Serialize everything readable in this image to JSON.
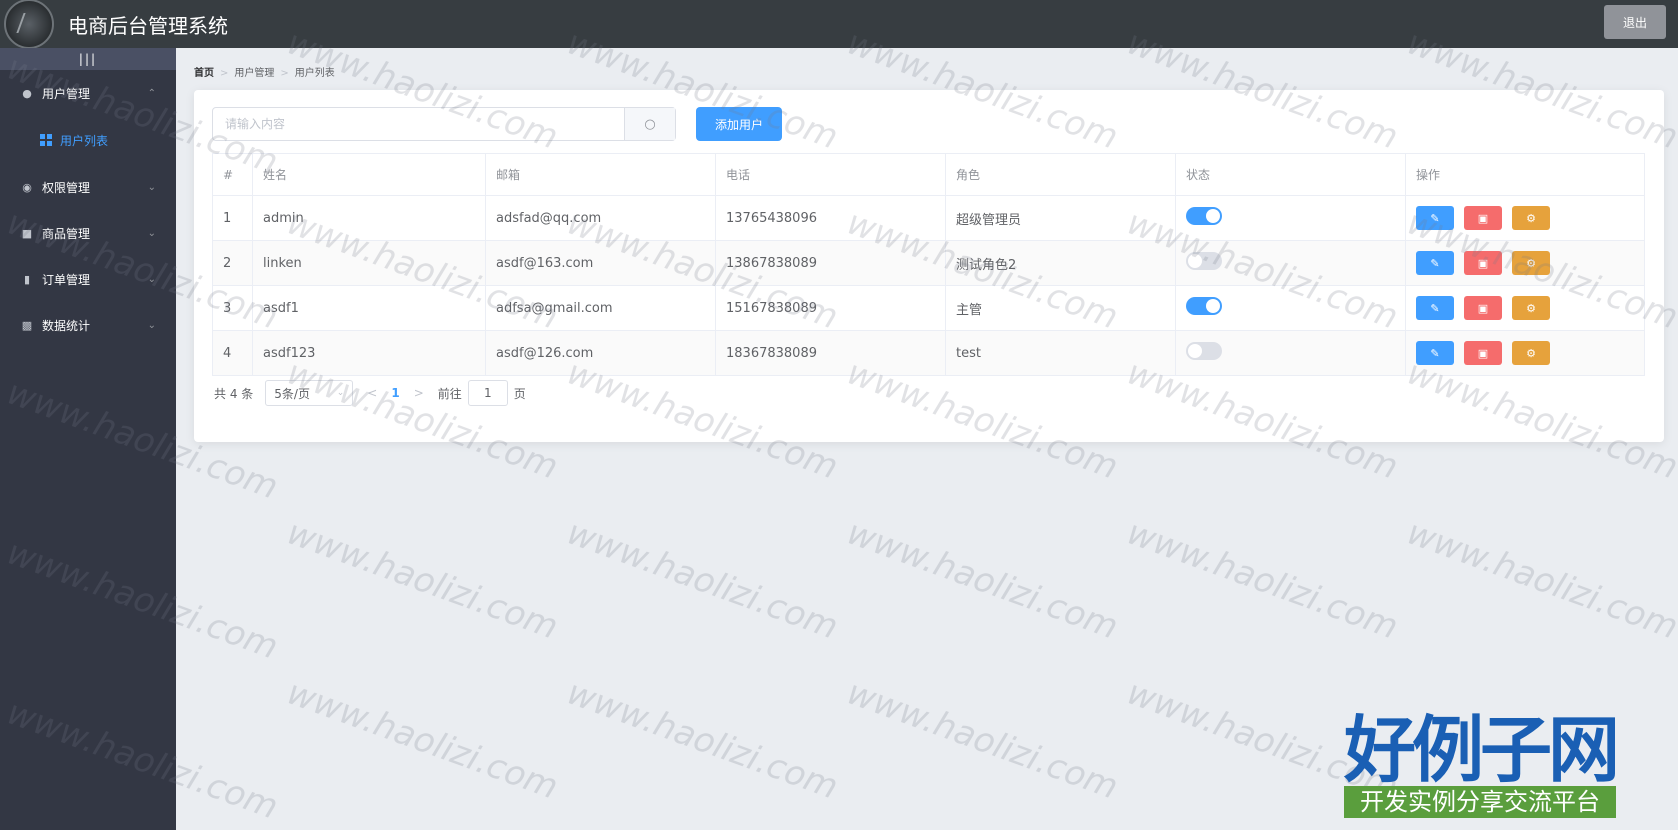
{
  "header": {
    "title": "电商后台管理系统",
    "logout_label": "退出"
  },
  "sidebar": {
    "toggle_label": "|||",
    "menus": [
      {
        "label": "用户管理",
        "icon": "user-icon",
        "chevron": "⌃"
      },
      {
        "label": "权限管理",
        "icon": "location-icon",
        "chevron": "⌄"
      },
      {
        "label": "商品管理",
        "icon": "goods-icon",
        "chevron": "⌄"
      },
      {
        "label": "订单管理",
        "icon": "order-icon",
        "chevron": "⌄"
      },
      {
        "label": "数据统计",
        "icon": "chart-icon",
        "chevron": "⌄"
      }
    ],
    "submenu": {
      "label": "用户列表",
      "icon": "grid-icon"
    }
  },
  "breadcrumb": [
    "首页",
    "用户管理",
    "用户列表"
  ],
  "search": {
    "placeholder": "请输入内容",
    "value": ""
  },
  "add_button_label": "添加用户",
  "table": {
    "columns": [
      "#",
      "姓名",
      "邮箱",
      "电话",
      "角色",
      "状态",
      "操作"
    ],
    "rows": [
      {
        "index": "1",
        "name": "admin",
        "email": "adsfad@qq.com",
        "phone": "13765438096",
        "role": "超级管理员",
        "status": true
      },
      {
        "index": "2",
        "name": "linken",
        "email": "asdf@163.com",
        "phone": "13867838089",
        "role": "测试角色2",
        "status": false
      },
      {
        "index": "3",
        "name": "asdf1",
        "email": "adfsa@gmail.com",
        "phone": "15167838089",
        "role": "主管",
        "status": true
      },
      {
        "index": "4",
        "name": "asdf123",
        "email": "asdf@126.com",
        "phone": "18367838089",
        "role": "test",
        "status": false
      }
    ]
  },
  "pagination": {
    "total_text": "共 4 条",
    "page_size": "5条/页",
    "current_page": "1",
    "goto_prefix": "前往",
    "goto_value": "1",
    "goto_suffix": "页"
  },
  "watermark": {
    "text": "www.haolizi.com"
  },
  "brand": {
    "title": "好例子网",
    "subtitle": "开发实例分享交流平台"
  },
  "colors": {
    "primary": "#409eff",
    "danger": "#f56c6c",
    "warning": "#e6a23c",
    "sidebar": "#333744",
    "header": "#373d41"
  }
}
